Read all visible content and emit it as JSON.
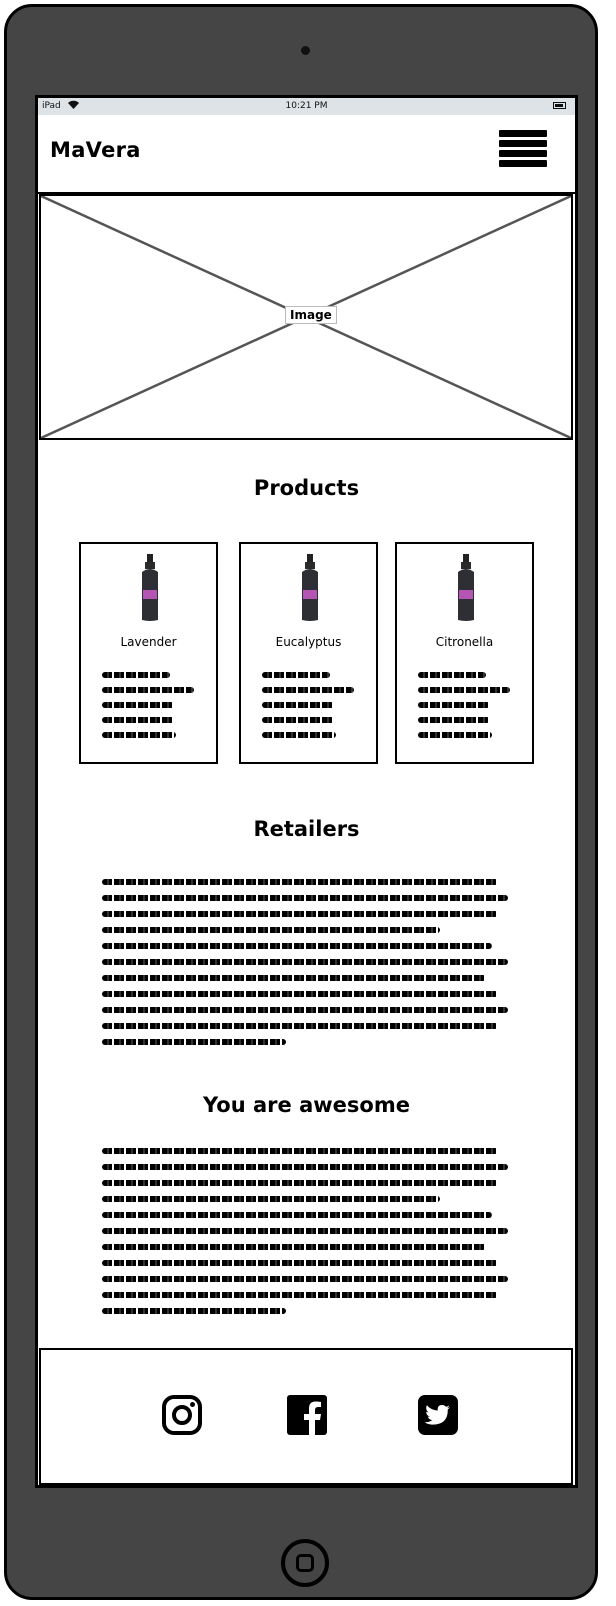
{
  "statusbar": {
    "carrier": "iPad",
    "time": "10:21 PM"
  },
  "header": {
    "brand": "MaVera"
  },
  "hero": {
    "label": "Image"
  },
  "products": {
    "title": "Products",
    "items": [
      {
        "name": "Lavender"
      },
      {
        "name": "Eucalyptus"
      },
      {
        "name": "Citronella"
      }
    ]
  },
  "retailers": {
    "title": "Retailers"
  },
  "awesome": {
    "title": "You are awesome"
  },
  "footer": {
    "icons": [
      "instagram-icon",
      "facebook-icon",
      "twitter-icon"
    ]
  },
  "colors": {
    "device": "#454545",
    "statusbar": "#dde3e6",
    "bottle_label": "#b455b4"
  }
}
